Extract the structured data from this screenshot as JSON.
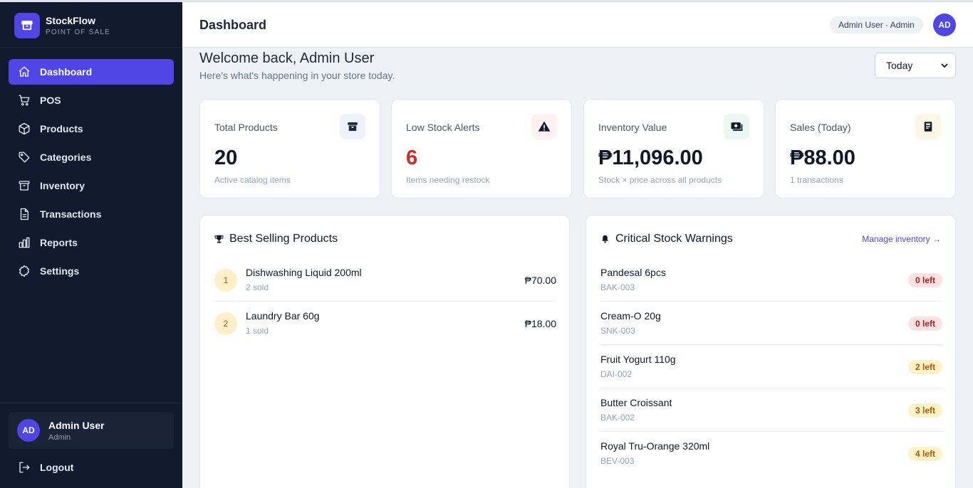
{
  "brand": {
    "name": "StockFlow",
    "subtitle": "POINT OF SALE"
  },
  "sidebar": {
    "items": [
      {
        "label": "Dashboard",
        "icon": "home-icon",
        "active": true
      },
      {
        "label": "POS",
        "icon": "cart-icon"
      },
      {
        "label": "Products",
        "icon": "cube-icon"
      },
      {
        "label": "Categories",
        "icon": "tag-icon"
      },
      {
        "label": "Inventory",
        "icon": "archive-icon"
      },
      {
        "label": "Transactions",
        "icon": "document-icon"
      },
      {
        "label": "Reports",
        "icon": "bar-chart-icon"
      },
      {
        "label": "Settings",
        "icon": "gear-icon"
      }
    ],
    "user": {
      "initials": "AD",
      "name": "Admin User",
      "role": "Admin"
    },
    "logout_label": "Logout"
  },
  "header": {
    "title": "Dashboard",
    "role_pill": "Admin User · Admin",
    "avatar_initials": "AD"
  },
  "welcome": {
    "title": "Welcome back, Admin User",
    "subtitle": "Here's what's happening in your store today."
  },
  "period_select": {
    "value": "Today"
  },
  "stats": [
    {
      "label": "Total Products",
      "value": "20",
      "sub": "Active catalog items",
      "icon": "archive-icon"
    },
    {
      "label": "Low Stock Alerts",
      "value": "6",
      "sub": "Items needing restock",
      "icon": "warning-icon"
    },
    {
      "label": "Inventory Value",
      "value": "₱11,096.00",
      "sub": "Stock × price across all products",
      "icon": "cash-icon"
    },
    {
      "label": "Sales (Today)",
      "value": "₱88.00",
      "sub": "1 transactions",
      "icon": "receipt-icon"
    }
  ],
  "colors": {
    "accent": "#4f46e5",
    "sidebar_bg": "#111a2e",
    "danger": "#dc2626"
  },
  "best_selling": {
    "title": "Best Selling Products",
    "items": [
      {
        "rank": "1",
        "name": "Dishwashing Liquid 200ml",
        "sold": "2 sold",
        "amount": "₱70.00"
      },
      {
        "rank": "2",
        "name": "Laundry Bar 60g",
        "sold": "1 sold",
        "amount": "₱18.00"
      }
    ]
  },
  "critical_stock": {
    "title": "Critical Stock Warnings",
    "link": "Manage inventory →",
    "items": [
      {
        "name": "Pandesal 6pcs",
        "sku": "BAK-003",
        "badge": "0 left",
        "level": "red"
      },
      {
        "name": "Cream-O 20g",
        "sku": "SNK-003",
        "badge": "0 left",
        "level": "red"
      },
      {
        "name": "Fruit Yogurt 110g",
        "sku": "DAI-002",
        "badge": "2 left",
        "level": "amber"
      },
      {
        "name": "Butter Croissant",
        "sku": "BAK-002",
        "badge": "3 left",
        "level": "amber"
      },
      {
        "name": "Royal Tru-Orange 320ml",
        "sku": "BEV-003",
        "badge": "4 left",
        "level": "amber"
      }
    ]
  }
}
